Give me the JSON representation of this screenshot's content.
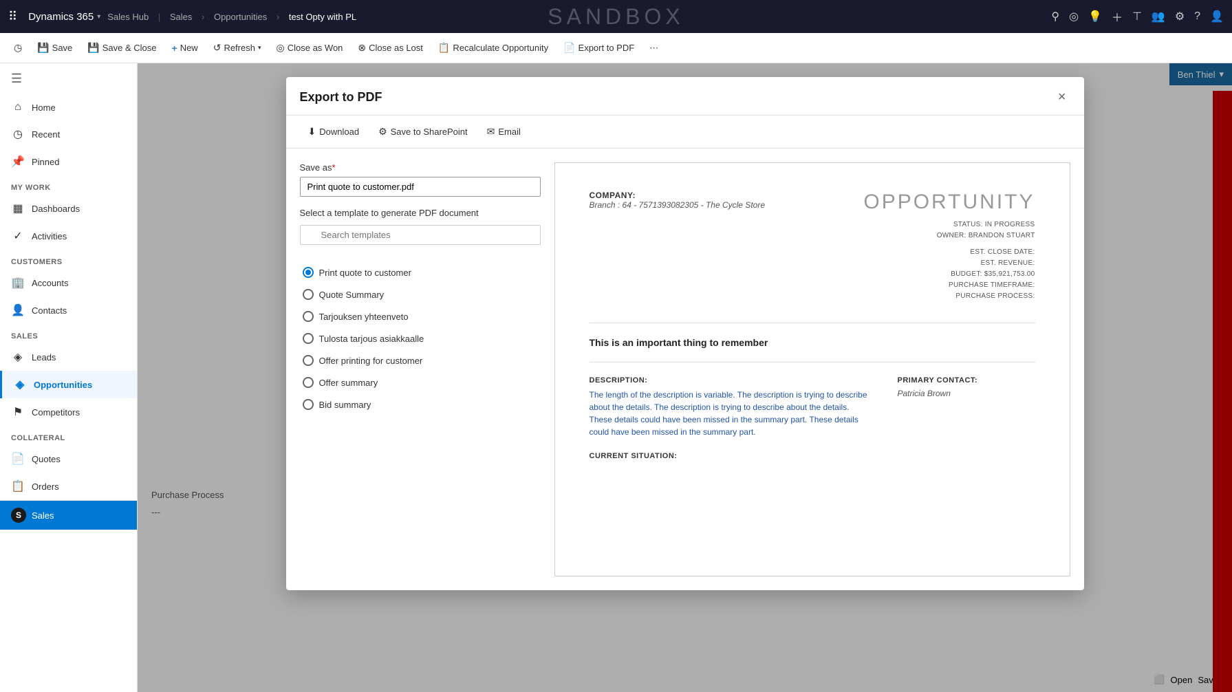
{
  "topnav": {
    "brand": "Dynamics 365",
    "chevron": "▾",
    "nav_section1": "Sales Hub",
    "nav_sales": "Sales",
    "sep1": ">",
    "nav_opps": "Opportunities",
    "sep2": ">",
    "nav_record": "test Opty with PL",
    "sandbox": "SANDBOX",
    "icons": [
      "⚲",
      "◎",
      "♦",
      "+",
      "⊤",
      "⚇",
      "⚙",
      "?",
      "⚐"
    ]
  },
  "commandbar": {
    "buttons": [
      {
        "label": "Save",
        "icon": "💾"
      },
      {
        "label": "Save & Close",
        "icon": "💾"
      },
      {
        "label": "New",
        "icon": "+"
      },
      {
        "label": "Refresh",
        "icon": "↺"
      },
      {
        "label": "Close as Won",
        "icon": "◎"
      },
      {
        "label": "Close as Lost",
        "icon": "⊗"
      },
      {
        "label": "Recalculate Opportunity",
        "icon": "📋"
      },
      {
        "label": "Export to PDF",
        "icon": "📄"
      }
    ]
  },
  "sidebar": {
    "hamburger": "☰",
    "items_main": [
      {
        "label": "Home",
        "icon": "⌂"
      },
      {
        "label": "Recent",
        "icon": "◷"
      },
      {
        "label": "Pinned",
        "icon": "📌"
      }
    ],
    "section_mywork": "My Work",
    "items_mywork": [
      {
        "label": "Dashboards",
        "icon": "▦"
      },
      {
        "label": "Activities",
        "icon": "✓"
      }
    ],
    "section_customers": "Customers",
    "items_customers": [
      {
        "label": "Accounts",
        "icon": "🏢"
      },
      {
        "label": "Contacts",
        "icon": "👤"
      }
    ],
    "section_sales": "Sales",
    "items_sales": [
      {
        "label": "Leads",
        "icon": "◈"
      },
      {
        "label": "Opportunities",
        "icon": "◈",
        "active": true
      },
      {
        "label": "Competitors",
        "icon": "⚑"
      }
    ],
    "section_collateral": "Collateral",
    "items_collateral": [
      {
        "label": "Quotes",
        "icon": "📄"
      },
      {
        "label": "Orders",
        "icon": "📋"
      }
    ],
    "items_bottom": [
      {
        "label": "Sales",
        "icon": "S",
        "active": false
      }
    ]
  },
  "modal": {
    "title": "Export to PDF",
    "close_label": "×",
    "toolbar": {
      "download_label": "Download",
      "download_icon": "⬇",
      "sharepoint_label": "Save to SharePoint",
      "sharepoint_icon": "⚙",
      "email_label": "Email",
      "email_icon": "✉"
    },
    "save_as_label": "Save as",
    "required_marker": "*",
    "save_as_value": "Print quote to customer.pdf",
    "template_prompt": "Select a template to generate PDF document",
    "search_placeholder": "Search templates",
    "templates": [
      {
        "id": "t1",
        "label": "Print quote to customer",
        "selected": true
      },
      {
        "id": "t2",
        "label": "Quote Summary",
        "selected": false
      },
      {
        "id": "t3",
        "label": "Tarjouksen yhteenveto",
        "selected": false
      },
      {
        "id": "t4",
        "label": "Tulosta tarjous asiakkaalle",
        "selected": false
      },
      {
        "id": "t5",
        "label": "Offer printing for customer",
        "selected": false
      },
      {
        "id": "t6",
        "label": "Offer summary",
        "selected": false
      },
      {
        "id": "t7",
        "label": "Bid summary",
        "selected": false
      }
    ],
    "preview": {
      "company_label": "COMPANY:",
      "company_detail": "Branch : 64 - 7571393082305 - The Cycle Store",
      "opportunity_title": "OPPORTUNITY",
      "status_lines": [
        "STATUS: IN PROGRESS",
        "OWNER: BRANDON STUART",
        "",
        "EST. CLOSE DATE:",
        "EST. REVENUE:",
        "BUDGET: $35,921,753.00",
        "PURCHASE TIMEFRAME:",
        "PURCHASE PROCESS:"
      ],
      "important_heading": "This is an important thing to remember",
      "description_label": "DESCRIPTION:",
      "description_text": "The length of the description is variable. The description is trying to describe about the details. The description is trying to describe about the details. These details could have been missed in the summary part. These details could have been missed in the summary part.",
      "primary_contact_label": "PRIMARY CONTACT:",
      "primary_contact_name": "Patricia Brown",
      "current_situation_label": "CURRENT SITUATION:"
    }
  },
  "bg": {
    "purchase_process_label": "Purchase Process",
    "dashes": "---",
    "open_label": "Open",
    "save_label": "Save",
    "ben_thiel": "Ben Thiel"
  }
}
